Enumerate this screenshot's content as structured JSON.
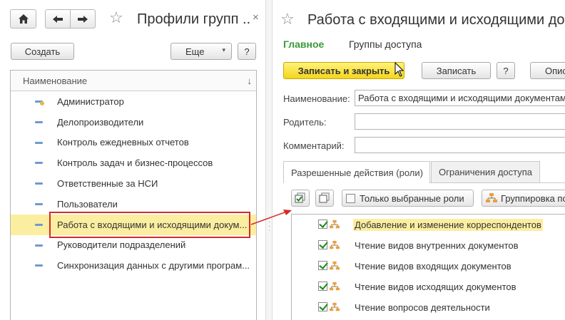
{
  "left": {
    "title": "Профили групп ...",
    "close": "×",
    "create_label": "Создать",
    "more_label": "Еще",
    "help_label": "?",
    "list_header": "Наименование",
    "sort_arrow": "↓",
    "items": [
      {
        "label": "Администратор"
      },
      {
        "label": "Делопроизводители"
      },
      {
        "label": "Контроль ежедневных отчетов"
      },
      {
        "label": "Контроль задач и бизнес-процессов"
      },
      {
        "label": "Ответственные за НСИ"
      },
      {
        "label": "Пользователи"
      },
      {
        "label": "Работа с входящими и исходящими докум..."
      },
      {
        "label": "Руководители подразделений"
      },
      {
        "label": "Синхронизация данных с другими програм..."
      }
    ]
  },
  "right": {
    "title": "Работа с входящими и исходящими докум",
    "tabs": {
      "main": "Главное",
      "groups": "Группы доступа"
    },
    "write_close_label": "Записать и закрыть",
    "write_label": "Записать",
    "help_label": "?",
    "description_label": "Опис",
    "fields": {
      "name_label": "Наименование:",
      "name_value": "Работа с входящими и исходящими документам",
      "parent_label": "Родитель:",
      "parent_value": "",
      "comment_label": "Комментарий:",
      "comment_value": ""
    },
    "subtabs": {
      "roles": "Разрешенные действия (роли)",
      "restrictions": "Ограничения доступа"
    },
    "toolbar": {
      "only_selected": "Только выбранные роли",
      "grouping": "Группировка по"
    },
    "roles": [
      {
        "label": "Добавление и изменение корреспондентов"
      },
      {
        "label": "Чтение видов внутренних документов"
      },
      {
        "label": "Чтение видов входящих документов"
      },
      {
        "label": "Чтение видов исходящих документов"
      },
      {
        "label": "Чтение вопросов деятельности"
      }
    ]
  },
  "colors": {
    "accent_green": "#3a9a3a",
    "selection_yellow": "#fbeea0",
    "primary_button": "#f4d61c",
    "highlight_red": "#d42a2a"
  }
}
